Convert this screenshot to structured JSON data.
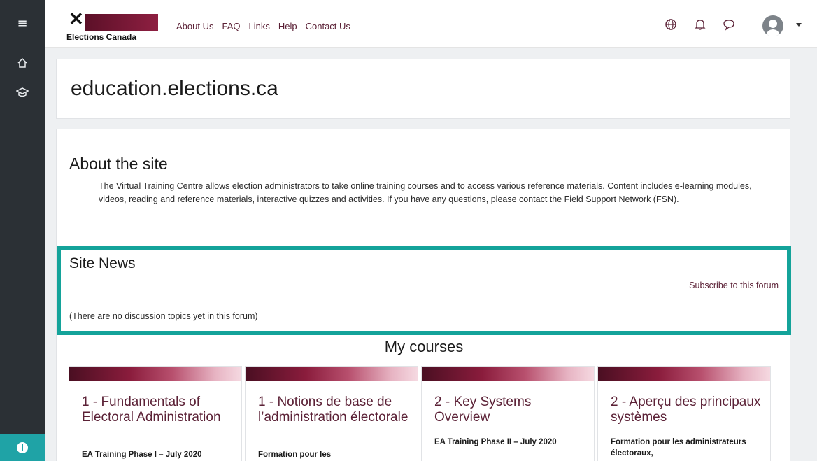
{
  "header": {
    "logo_text": "Elections Canada",
    "nav": [
      "About Us",
      "FAQ",
      "Links",
      "Help",
      "Contact Us"
    ]
  },
  "site": {
    "title": "education.elections.ca"
  },
  "about": {
    "heading": "About the site",
    "text": "The Virtual Training Centre allows election administrators to take online training courses and to access various reference materials. Content includes e-learning modules, videos, reading and reference materials, interactive quizzes and activities. If you have any questions, please contact the Field Support Network (FSN)."
  },
  "news": {
    "heading": "Site News",
    "subscribe": "Subscribe to this forum",
    "empty": "(There are no discussion topics yet in this forum)"
  },
  "courses": {
    "heading": "My courses",
    "items": [
      {
        "title": "1 - Fundamentals of Electoral Administration",
        "desc": "EA Training Phase I – July 2020"
      },
      {
        "title": "1 - Notions de base de l’administration électorale",
        "desc": "Formation pour les"
      },
      {
        "title": "2 - Key Systems Overview",
        "desc": "EA Training Phase II – July 2020"
      },
      {
        "title": "2 - Aperçu des principaux systèmes",
        "desc": "Formation pour les administrateurs électoraux,"
      }
    ]
  },
  "icons": {
    "menu": "hamburger-icon",
    "home": "home-icon",
    "courses": "graduation-cap-icon",
    "globe": "globe-icon",
    "bell": "bell-icon",
    "chat": "chat-icon",
    "accessibility": "accessibility-icon"
  },
  "colors": {
    "rail": "#2b3035",
    "accent": "#14a39a",
    "brand": "#5b2136"
  }
}
